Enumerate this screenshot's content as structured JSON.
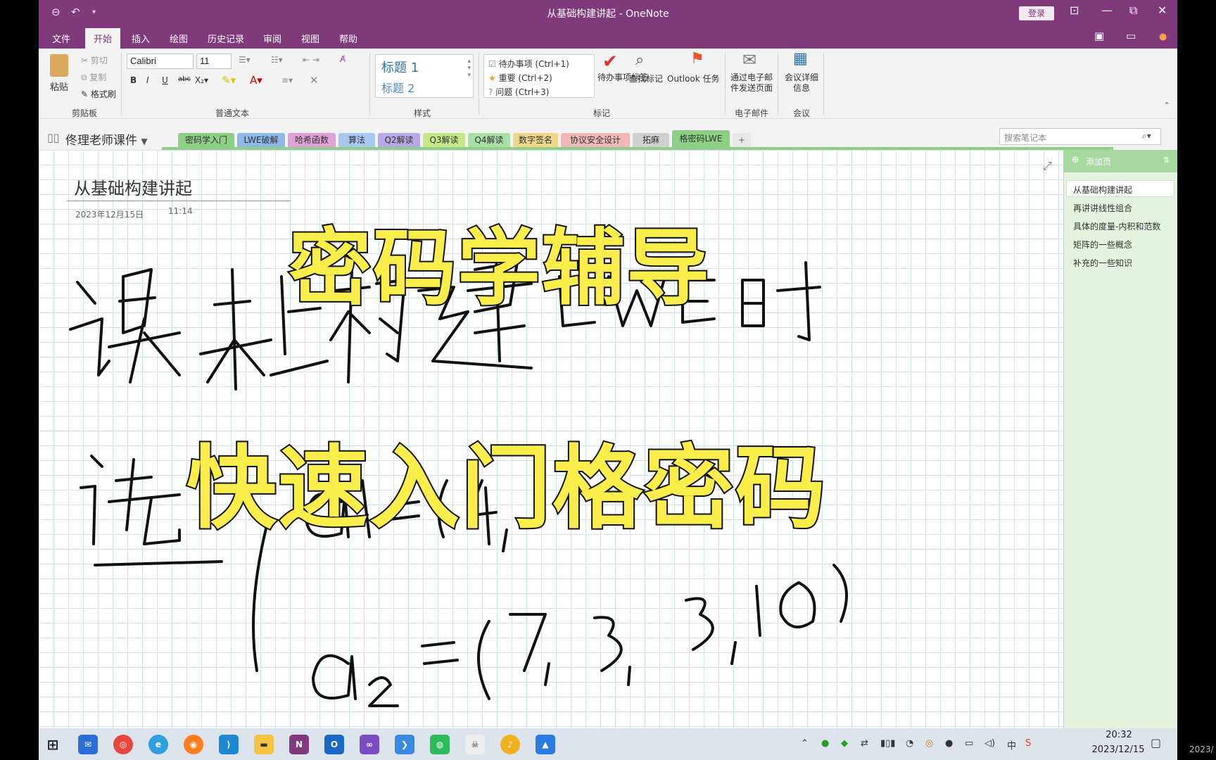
{
  "window": {
    "title": "从基础构建讲起 - OneNote",
    "login": "登录",
    "minimize": "—",
    "restore": "⧉",
    "close": "✕"
  },
  "menu": [
    "文件",
    "开始",
    "插入",
    "绘图",
    "历史记录",
    "审阅",
    "视图",
    "帮助"
  ],
  "menu_active": "开始",
  "ribbon": {
    "clipboard": {
      "paste": "粘贴",
      "cut": "剪切",
      "copy": "复制",
      "format_painter": "格式刷",
      "label": "剪贴板"
    },
    "text": {
      "font": "Calibri",
      "size": "11",
      "label": "普通文本"
    },
    "styles": {
      "heading1": "标题 1",
      "heading2": "标题 2",
      "label": "样式"
    },
    "tags": {
      "todo": "待办事项 (Ctrl+1)",
      "important": "重要 (Ctrl+2)",
      "question": "问题 (Ctrl+3)",
      "todo_tag": "待办事项标签",
      "find_tags": "查找标记",
      "outlook_tasks": "Outlook 任务",
      "label": "标记"
    },
    "email": {
      "send": "通过电子邮件发送页面",
      "label": "电子邮件"
    },
    "meeting": {
      "details": "会议详细信息",
      "label": "会议"
    }
  },
  "notebook": {
    "name": "佟理老师课件",
    "sections": [
      "密码学入门",
      "LWE破解",
      "哈希函数",
      "算法",
      "Q2解读",
      "Q3解读",
      "Q4解读",
      "数字签名",
      "协议安全设计",
      "拓麻",
      "格密码LWE"
    ],
    "active_section": "格密码LWE",
    "add_section": "+",
    "search_placeholder": "搜索笔记本"
  },
  "page": {
    "title": "从基础构建讲起",
    "date": "2023年12月15日",
    "time": "11:14"
  },
  "pages_pane": {
    "add_page": "添加页",
    "items": [
      "从基础构建讲起",
      "再讲讲线性组合",
      "具体的度量-内积和范数",
      "矩阵的一些概念",
      "补充的一些知识"
    ]
  },
  "overlay": {
    "line1": "密码学辅导",
    "line2": "快速入门格密码"
  },
  "taskbar": {
    "clock_time": "20:32",
    "clock_date": "2023/12/15",
    "apps": [
      "win",
      "mail",
      "chrome",
      "edge",
      "firefox",
      "vscode",
      "explorer",
      "onenote",
      "outlook",
      "vs",
      "bird",
      "wechat",
      "wolf",
      "music",
      "meeting"
    ],
    "edge_date": "2023/"
  },
  "colors": {
    "accent": "#80397b",
    "section_green": "#8ccf85",
    "overlay_yellow": "#f9ed4b"
  }
}
